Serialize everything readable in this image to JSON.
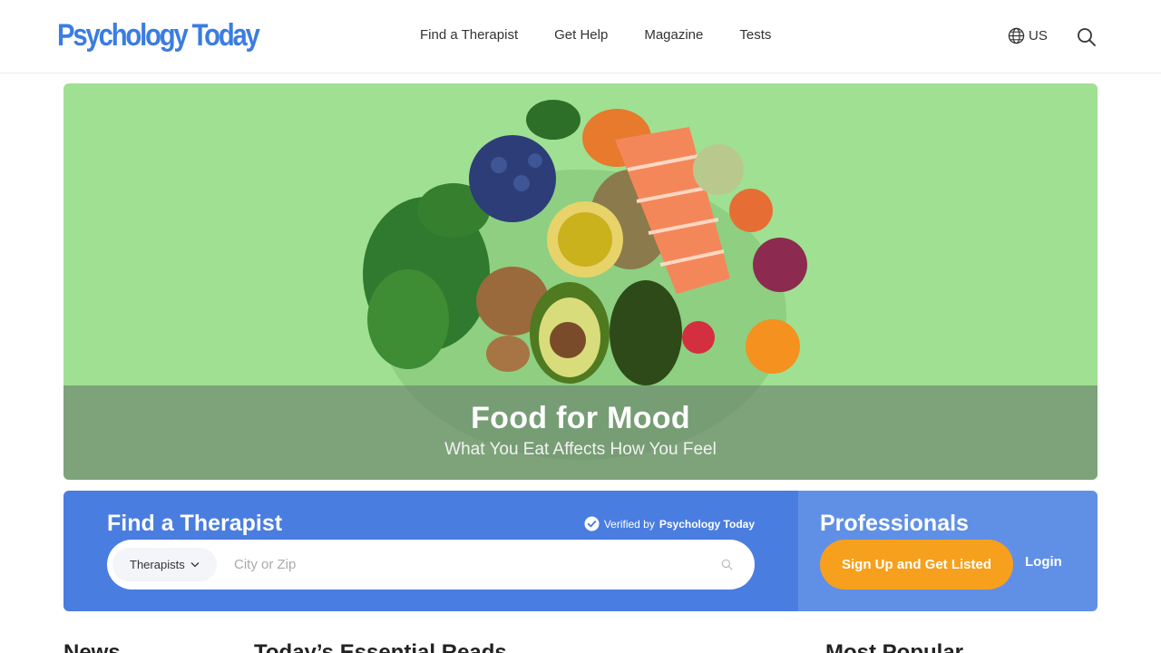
{
  "header": {
    "logo": "Psychology Today",
    "nav": [
      "Find a Therapist",
      "Get Help",
      "Magazine",
      "Tests"
    ],
    "region": "US",
    "icons": {
      "region": "globe-icon",
      "search": "search-icon"
    }
  },
  "hero": {
    "title": "Food for Mood",
    "subtitle": "What You Eat Affects How You Feel"
  },
  "finder": {
    "title": "Find a Therapist",
    "verified_prefix": "Verified by",
    "verified_brand": "Psychology Today",
    "type_selected": "Therapists",
    "city_placeholder": "City or Zip"
  },
  "professionals": {
    "title": "Professionals",
    "signup_label": "Sign Up and Get Listed",
    "login_label": "Login"
  },
  "sections": {
    "news": "News",
    "essential": "Today’s Essential Reads",
    "popular": "Most Popular"
  },
  "colors": {
    "brand_blue": "#3b7de0",
    "finder_bg": "#4a7de0",
    "pros_bg": "#6090e6",
    "cta_orange": "#f7a01d",
    "hero_green": "#a0e092"
  }
}
